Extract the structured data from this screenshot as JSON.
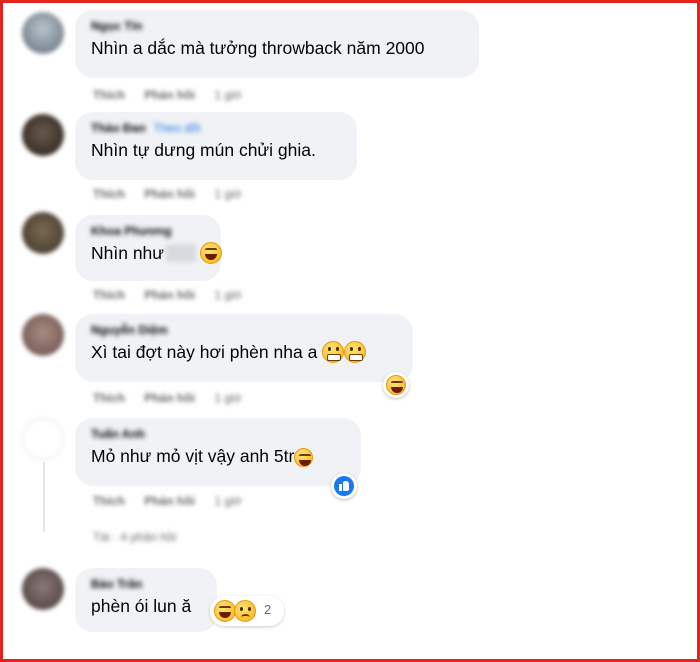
{
  "comments": [
    {
      "author": "Ngọc Tín",
      "tag": "",
      "text": "Nhìn a dắc mà tưởng throwback năm 2000",
      "actions": {
        "like": "Thích",
        "reply": "Phản hồi",
        "time": "1 giờ"
      }
    },
    {
      "author": "Thảo Đan",
      "tag": "Theo dõi",
      "text": "Nhìn tự dưng mún chửi ghia.",
      "actions": {
        "like": "Thích",
        "reply": "Phản hồi",
        "time": "1 giờ"
      }
    },
    {
      "author": "Khoa Phương",
      "tag": "",
      "text": "Nhìn như",
      "actions": {
        "like": "Thích",
        "reply": "Phản hồi",
        "time": "1 giờ"
      }
    },
    {
      "author": "Nguyễn Diệm",
      "tag": "",
      "text": "Xì tai đợt này hơi phèn nha a",
      "actions": {
        "like": "Thích",
        "reply": "Phản hồi",
        "time": "1 giờ"
      }
    },
    {
      "author": "Tuấn Anh",
      "tag": "",
      "text": "Mỏ như mỏ vịt vậy anh 5tr",
      "actions": {
        "like": "Thích",
        "reply": "Phản hồi",
        "time": "1 giờ"
      },
      "reply_note": "Tài · 4 phản hồi"
    },
    {
      "author": "Bảo Trân",
      "tag": "",
      "text": "phèn ói lun ă",
      "reaction_count": "2"
    }
  ],
  "icons": {
    "laugh": "laughing-face-emoji",
    "grimace": "grimacing-face-emoji",
    "sad": "sad-face-emoji",
    "like": "like-thumb-icon"
  },
  "colors": {
    "frame": "#e2241c",
    "bubble": "#f0f2f5",
    "like": "#1877f2"
  }
}
